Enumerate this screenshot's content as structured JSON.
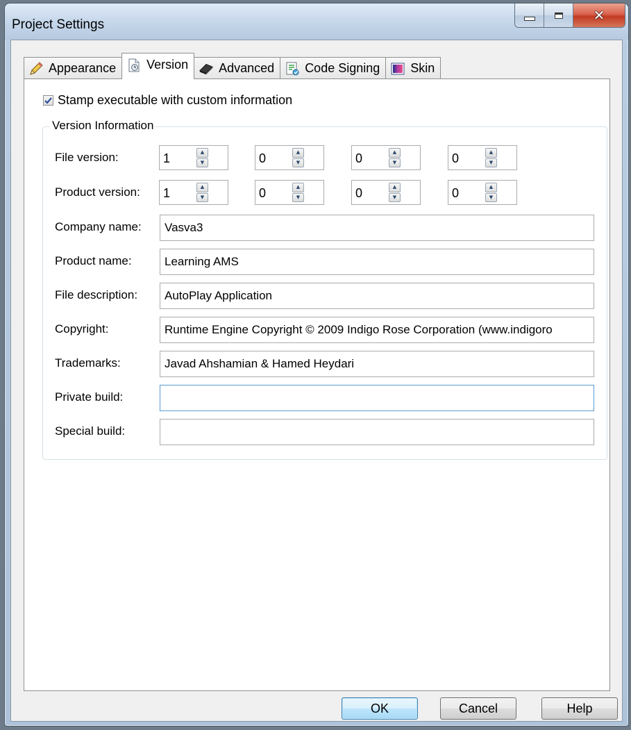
{
  "window": {
    "title": "Project Settings"
  },
  "tabs": [
    {
      "label": "Appearance",
      "icon": "pencil-icon",
      "active": false
    },
    {
      "label": "Version",
      "icon": "version-document-icon",
      "active": true
    },
    {
      "label": "Advanced",
      "icon": "advanced-chip-icon",
      "active": false
    },
    {
      "label": "Code Signing",
      "icon": "code-signing-icon",
      "active": false
    },
    {
      "label": "Skin",
      "icon": "skin-icon",
      "active": false
    }
  ],
  "stamp": {
    "label": "Stamp executable with custom information",
    "checked": true
  },
  "version_info": {
    "legend": "Version Information",
    "file_version": {
      "label": "File version:",
      "parts": [
        "1",
        "0",
        "0",
        "0"
      ]
    },
    "product_version": {
      "label": "Product version:",
      "parts": [
        "1",
        "0",
        "0",
        "0"
      ]
    },
    "fields": [
      {
        "label": "Company name:",
        "value": "Vasva3"
      },
      {
        "label": "Product name:",
        "value": "Learning AMS"
      },
      {
        "label": "File description:",
        "value": "AutoPlay Application"
      },
      {
        "label": "Copyright:",
        "value": "Runtime Engine Copyright © 2009 Indigo Rose Corporation (www.indigoro"
      },
      {
        "label": "Trademarks:",
        "value": "Javad Ahshamian & Hamed Heydari"
      },
      {
        "label": "Private build:",
        "value": ""
      },
      {
        "label": "Special build:",
        "value": ""
      }
    ]
  },
  "buttons": {
    "ok": "OK",
    "cancel": "Cancel",
    "help": "Help"
  },
  "colors": {
    "accent": "#3c7fb1",
    "close_button": "#c23a22",
    "panel": "#ffffff",
    "dialog": "#f0f0f0"
  }
}
